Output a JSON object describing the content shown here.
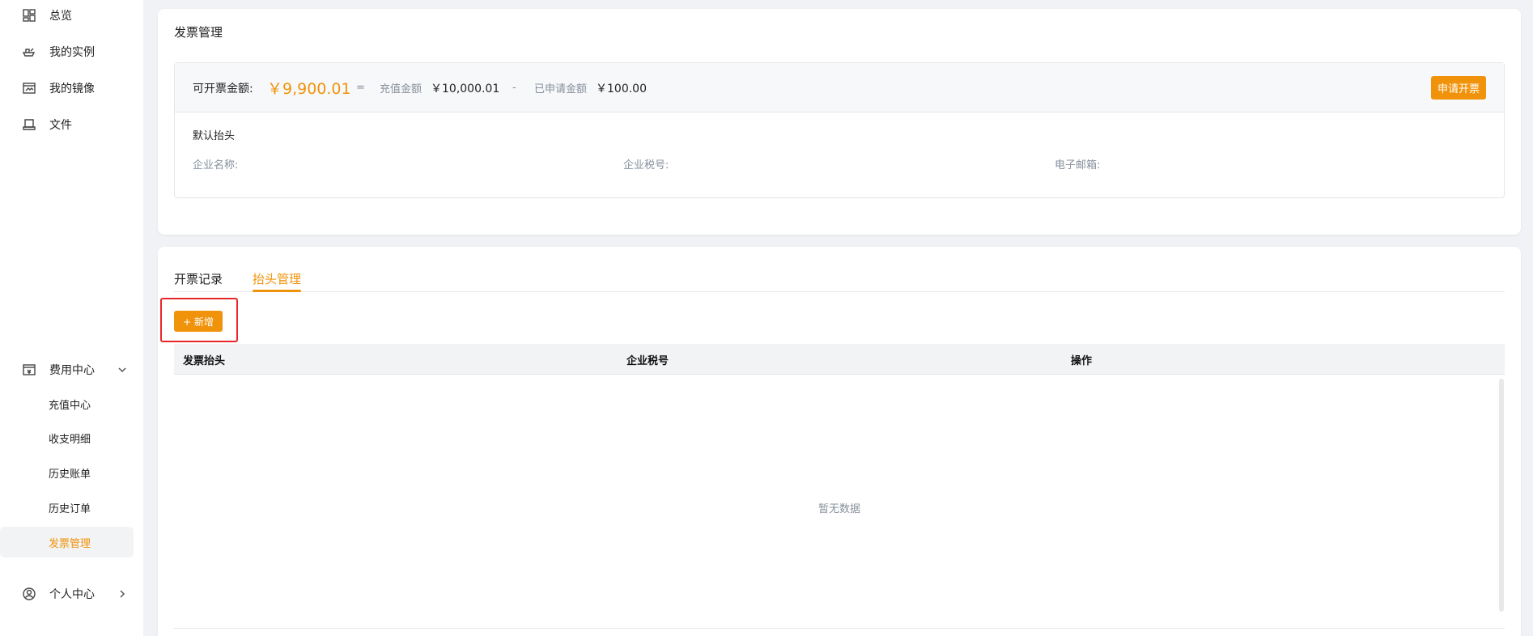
{
  "sidebar": {
    "nav": [
      {
        "label": "总览",
        "icon": "dashboard-icon"
      },
      {
        "label": "我的实例",
        "icon": "instance-icon"
      },
      {
        "label": "我的镜像",
        "icon": "image-icon"
      },
      {
        "label": "文件",
        "icon": "storage-icon"
      }
    ],
    "billing": {
      "label": "费用中心",
      "icon": "billing-icon",
      "items": [
        {
          "label": "充值中心"
        },
        {
          "label": "收支明细"
        },
        {
          "label": "历史账单"
        },
        {
          "label": "历史订单"
        },
        {
          "label": "发票管理"
        }
      ]
    },
    "personal": {
      "label": "个人中心",
      "icon": "user-circle-icon"
    }
  },
  "invoice": {
    "title": "发票管理",
    "available_label": "可开票金额:",
    "available_value": "￥9,900.01",
    "equals": "=",
    "recharge_label": "充值金额",
    "recharge_value": "￥10,000.01",
    "minus": "-",
    "applied_label": "已申请金额",
    "applied_value": "￥100.00",
    "apply_button": "申请开票",
    "default_header": "默认抬头",
    "company_name_label": "企业名称:",
    "tax_id_label": "企业税号:",
    "email_label": "电子邮箱:"
  },
  "tabs": [
    {
      "label": "开票记录",
      "active": false
    },
    {
      "label": "抬头管理",
      "active": true
    }
  ],
  "add_button": "+ 新增",
  "table": {
    "columns": [
      "发票抬头",
      "企业税号",
      "操作"
    ],
    "empty_text": "暂无数据"
  },
  "colors": {
    "accent": "#f0930a",
    "highlight": "#e8262a"
  }
}
